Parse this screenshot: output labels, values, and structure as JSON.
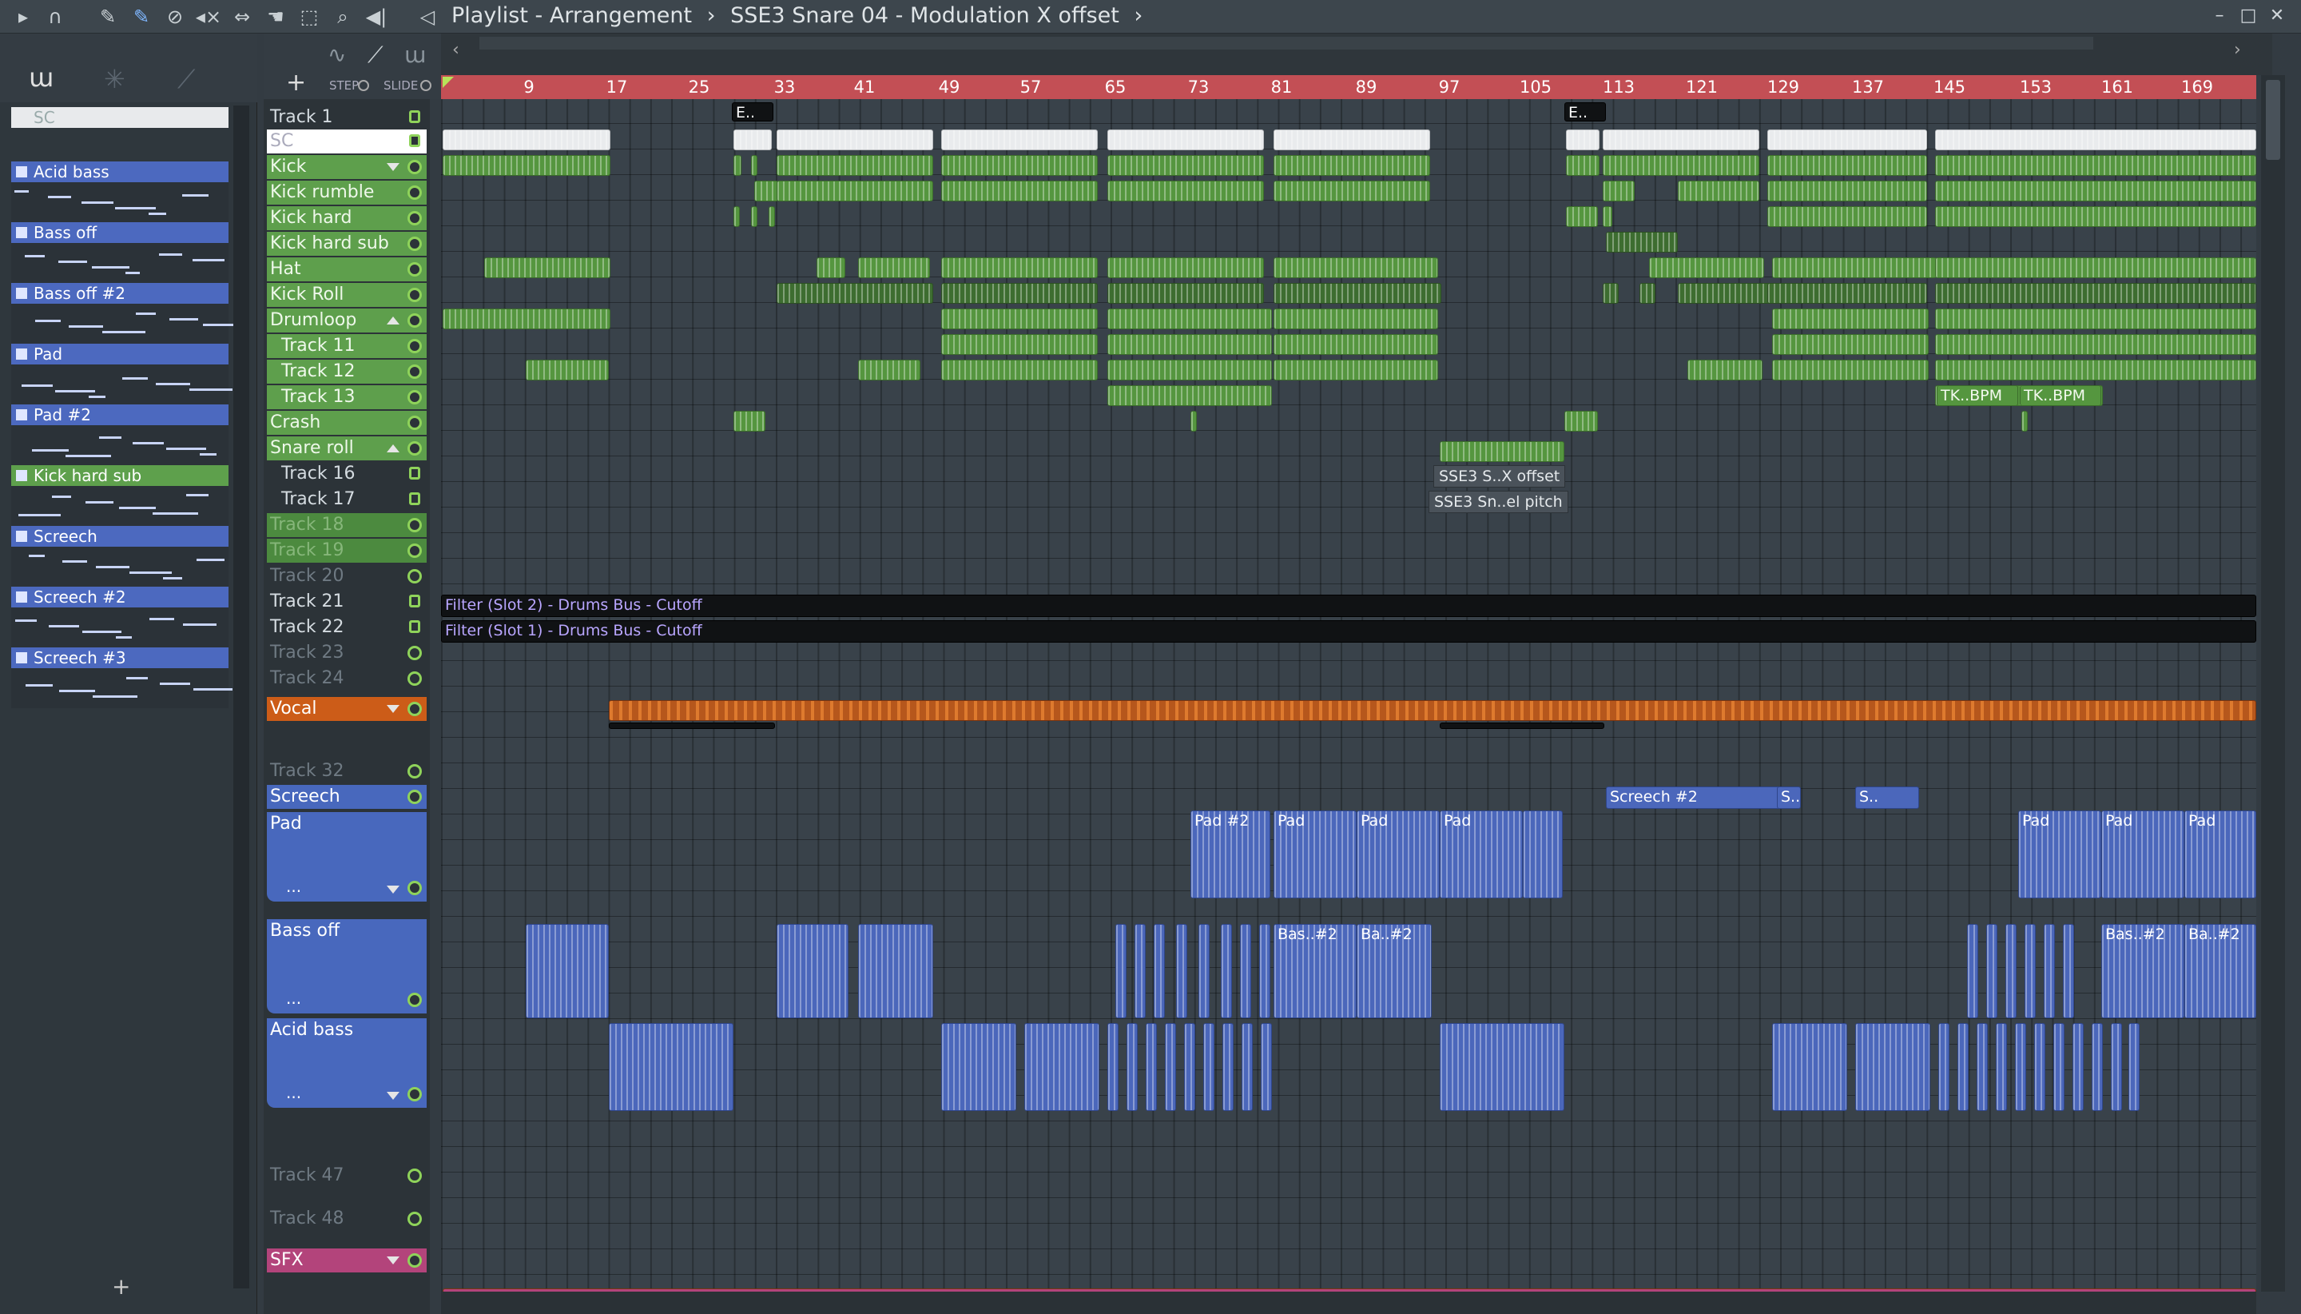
{
  "window": {
    "breadcrumb": [
      "Playlist - Arrangement",
      "SSE3 Snare 04 - Modulation X offset"
    ]
  },
  "toolbar": {
    "icons": [
      "play-arrow-icon",
      "magnet-icon",
      "draw-tool-icon",
      "paint-tool-icon",
      "delete-tool-icon",
      "mute-tool-icon",
      "slip-tool-icon",
      "slice-tool-icon",
      "select-tool-icon",
      "zoom-tool-icon",
      "playback-tool-icon",
      "speaker-icon"
    ],
    "step_label": "STEP",
    "slide_label": "SLIDE",
    "add_label": "+"
  },
  "browser": {
    "search_value": "SC",
    "add_label": "+",
    "patterns": [
      {
        "name": "Acid bass",
        "color": "blue"
      },
      {
        "name": "Bass off",
        "color": "blue"
      },
      {
        "name": "Bass off #2",
        "color": "blue"
      },
      {
        "name": "Pad",
        "color": "blue"
      },
      {
        "name": "Pad #2",
        "color": "blue"
      },
      {
        "name": "Kick hard sub",
        "color": "green"
      },
      {
        "name": "Screech",
        "color": "blue"
      },
      {
        "name": "Screech #2",
        "color": "blue"
      },
      {
        "name": "Screech #3",
        "color": "blue"
      }
    ]
  },
  "ruler": {
    "bars": [
      "9",
      "17",
      "25",
      "33",
      "41",
      "49",
      "57",
      "65",
      "73",
      "81",
      "89",
      "97",
      "105",
      "113",
      "121",
      "129",
      "137",
      "145",
      "153",
      "161",
      "169"
    ]
  },
  "tracks": [
    {
      "name": "Track 1"
    },
    {
      "name": "SC"
    },
    {
      "name": "Kick"
    },
    {
      "name": "Kick rumble"
    },
    {
      "name": "Kick hard"
    },
    {
      "name": "Kick hard sub"
    },
    {
      "name": "Hat"
    },
    {
      "name": "Kick Roll"
    },
    {
      "name": "Drumloop"
    },
    {
      "name": "Track 11"
    },
    {
      "name": "Track 12"
    },
    {
      "name": "Track 13"
    },
    {
      "name": "Crash"
    },
    {
      "name": "Snare roll"
    },
    {
      "name": "Track 16"
    },
    {
      "name": "Track 17"
    },
    {
      "name": "Track 18"
    },
    {
      "name": "Track 19"
    },
    {
      "name": "Track 20"
    },
    {
      "name": "Track 21"
    },
    {
      "name": "Track 22"
    },
    {
      "name": "Track 23"
    },
    {
      "name": "Track 24"
    },
    {
      "name": "Vocal"
    },
    {
      "name": "Track 32"
    },
    {
      "name": "Screech"
    },
    {
      "name": "Pad"
    },
    {
      "name": "Bass off"
    },
    {
      "name": "Acid bass"
    },
    {
      "name": "Track 47"
    },
    {
      "name": "Track 48"
    },
    {
      "name": "SFX"
    }
  ],
  "track_more": "...",
  "clips": {
    "automation_1": "Filter (Slot 2) - Drums Bus - Cutoff",
    "automation_2": "Filter (Slot 1) - Drums Bus - Cutoff",
    "snare_offset": "SSE3 S..X offset",
    "snare_pitch": "SSE3 Sn..el pitch",
    "e_short": "E..",
    "tk_bpm": "TK..BPM",
    "screech2": "Screech #2",
    "s_short": "S..",
    "pad2": "Pad #2",
    "pad": "Pad",
    "bas2": "Bas..#2",
    "ba2": "Ba..#2"
  },
  "colors": {
    "ruler": "#c34f55",
    "audio_green": "#55963f",
    "pattern_blue": "#4b67bb",
    "vocal_orange": "#b6571c",
    "sfx_pink": "#b3447b"
  }
}
